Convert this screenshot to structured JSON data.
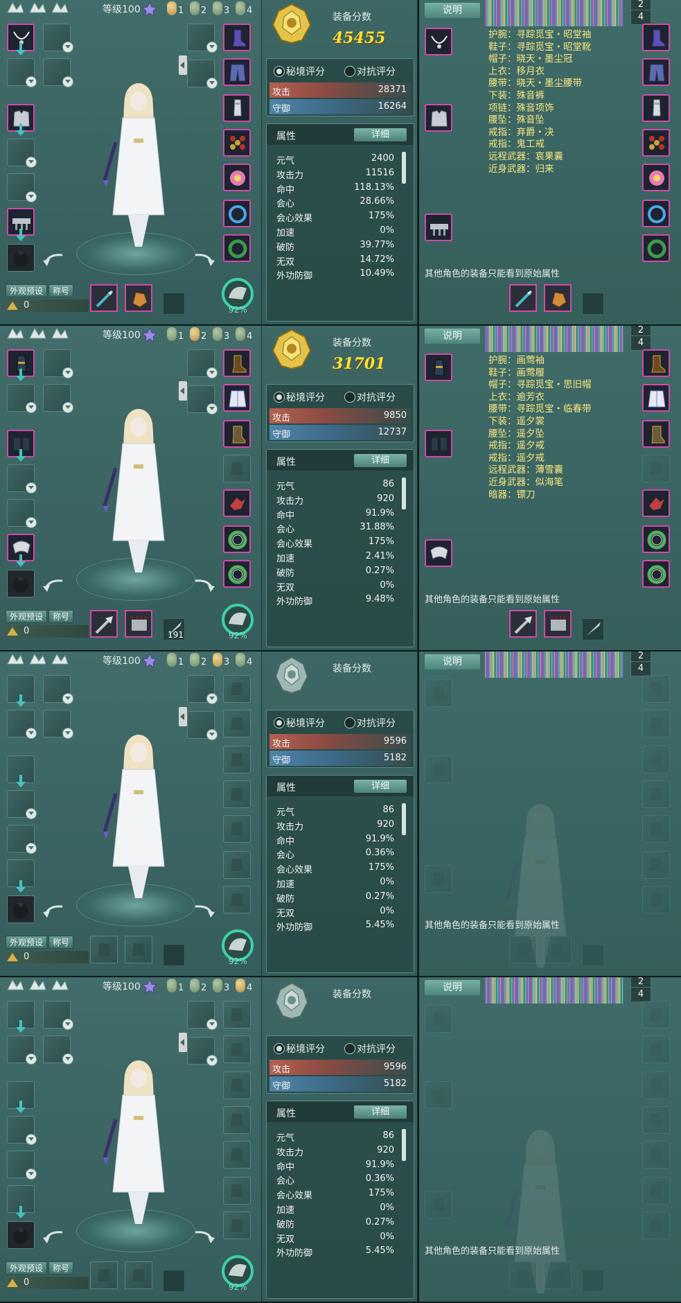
{
  "common": {
    "level_text": "等级100",
    "preset_numbers": [
      "1",
      "2",
      "3",
      "4"
    ],
    "appearance_btn": "外观预设",
    "title_btn": "称号",
    "currency_value": "0",
    "durability_pct": "92%",
    "score_title": "装备分数",
    "radio_secret": "秘境评分",
    "radio_pvp": "对抗评分",
    "atk_label": "攻击",
    "def_label": "守御",
    "attr_title": "属性",
    "detail_btn": "详细",
    "attr_names": [
      "元气",
      "攻击力",
      "命中",
      "会心",
      "会心效果",
      "加速",
      "破防",
      "无双",
      "外功防御"
    ],
    "desc_btn": "说明",
    "footnote": "其他角色的装备只能看到原始属性",
    "page_a": "2",
    "page_b": "4",
    "colors": {
      "score_gold": "#f7e03a",
      "equip_text": "#fae680",
      "slot_border": "#d04ba8",
      "accent_teal": "#47c1c2"
    }
  },
  "panels": [
    {
      "active_preset": 0,
      "score": "45455",
      "badge": "gold",
      "atk": "28371",
      "def": "16264",
      "attr_values": [
        "2400",
        "11516",
        "118.13%",
        "28.66%",
        "175%",
        "0%",
        "39.77%",
        "14.72%",
        "10.49%"
      ],
      "weapon_count": "",
      "has_equip": true,
      "equip_list": [
        "护腕：寻踪觅宝・昭堂袖",
        "鞋子：寻踪觅宝・昭堂靴",
        "帽子：晓天・墨尘冠",
        "上衣：移月衣",
        "腰带：晓天・墨尘腰带",
        "下装：殊音裤",
        "项链：殊音项饰",
        "腰坠：殊音坠",
        "戒指：弃爵・决",
        "戒指：鬼工戒",
        "远程武器：哀果囊",
        "近身武器：归来"
      ]
    },
    {
      "active_preset": 1,
      "score": "31701",
      "badge": "gold",
      "atk": "9850",
      "def": "12737",
      "attr_values": [
        "86",
        "920",
        "91.9%",
        "31.88%",
        "175%",
        "2.41%",
        "0.27%",
        "0%",
        "9.48%"
      ],
      "weapon_count": "191",
      "has_equip": true,
      "equip_list": [
        "护腕：画莺袖",
        "鞋子：画莺履",
        "帽子：寻踪觅宝・思旧帽",
        "上衣：逾芳衣",
        "腰带：寻踪觅宝・临春带",
        "下装：遥夕裳",
        "腰坠：遥夕坠",
        "戒指：遥夕戒",
        "戒指：遥夕戒",
        "远程武器：薄雪囊",
        "近身武器：似海笔",
        "暗器：镖刀"
      ]
    },
    {
      "active_preset": 2,
      "score": "",
      "badge": "silver",
      "atk": "9596",
      "def": "5182",
      "attr_values": [
        "86",
        "920",
        "91.9%",
        "0.36%",
        "175%",
        "0%",
        "0.27%",
        "0%",
        "5.45%"
      ],
      "weapon_count": "",
      "has_equip": false,
      "equip_list": []
    },
    {
      "active_preset": 3,
      "score": "",
      "badge": "silver",
      "atk": "9596",
      "def": "5182",
      "attr_values": [
        "86",
        "920",
        "91.9%",
        "0.36%",
        "175%",
        "0%",
        "0.27%",
        "0%",
        "5.45%"
      ],
      "weapon_count": "",
      "has_equip": false,
      "equip_list": []
    }
  ]
}
